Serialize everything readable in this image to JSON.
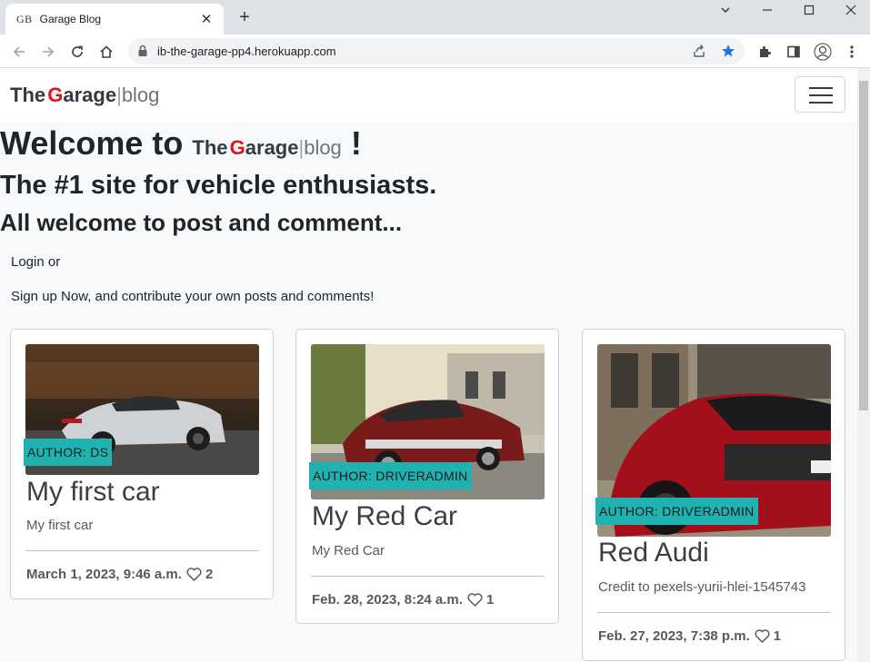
{
  "browser": {
    "tab_favicon": "GB",
    "tab_title": "Garage Blog",
    "tab_close": "✕",
    "new_tab": "+",
    "url": "ib-the-garage-pp4.herokuapp.com"
  },
  "navbar": {
    "brand": {
      "the": "The",
      "g": "G",
      "arage": "arage",
      "pipe": "|",
      "blog": "blog"
    }
  },
  "hero": {
    "welcome_prefix": "Welcome to",
    "welcome_suffix": "!",
    "subtitle": "The #1 site for vehicle enthusiasts.",
    "tagline": "All welcome to post and comment...",
    "login_text": "Login or",
    "signup_text": "Sign up Now, and contribute your own posts and comments!"
  },
  "posts": [
    {
      "author": "AUTHOR: DS",
      "title": "My first car",
      "excerpt": "My first car",
      "date": "March 1, 2023, 9:46 a.m.",
      "likes": "2"
    },
    {
      "author": "AUTHOR: DRIVERADMIN",
      "title": "My Red Car",
      "excerpt": "My Red Car",
      "date": "Feb. 28, 2023, 8:24 a.m.",
      "likes": "1"
    },
    {
      "author": "AUTHOR: DRIVERADMIN",
      "title": "Red Audi",
      "excerpt": "Credit to pexels-yurii-hlei-1545743",
      "date": "Feb. 27, 2023, 7:38 p.m.",
      "likes": "1"
    }
  ],
  "colors": {
    "accent_red": "#e3121b",
    "author_badge": "#20b2b0",
    "star_active": "#1a73e8"
  },
  "icons": [
    "lock-icon",
    "share-icon",
    "star-icon",
    "extensions-icon",
    "sidepanel-icon",
    "profile-icon",
    "kebab-menu-icon",
    "heart-icon",
    "hamburger-icon"
  ]
}
